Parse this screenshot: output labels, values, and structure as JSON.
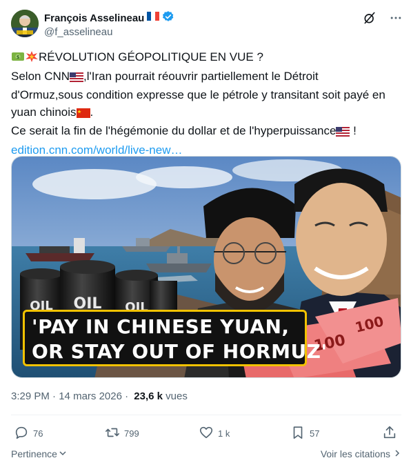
{
  "author": {
    "display_name": "François Asselineau",
    "handle": "@f_asselineau",
    "verified": true,
    "name_flag": "France flag"
  },
  "header_icons": [
    "grok-slash-icon",
    "more-dots-icon"
  ],
  "tweet": {
    "line1_text": "RÉVOLUTION GÉOPOLITIQUE EN VUE ?",
    "line2_a": "Selon CNN",
    "line2_b": ",l'Iran pourrait réouvrir partiellement le Détroit",
    "line3": "d'Ormuz,sous condition expresse que le pétrole y transitant soit payé en",
    "line4_a": "yuan chinois",
    "line4_b": ".",
    "line5_a": "Ce serait la fin de l'hégémonie du dollar et de l'hyperpuissance",
    "line5_b": " !",
    "link": "edition.cnn.com/world/live-new…"
  },
  "media": {
    "banner_line1": "'PAY IN CHINESE YUAN,",
    "banner_line2": "OR STAY OUT OF HORMUZ'",
    "barrel_label": "OIL"
  },
  "meta": {
    "time": "3:29 PM",
    "sep": " · ",
    "date": "14 mars 2026",
    "sep2": " · ",
    "views_count": "23,6 k",
    "views_label": " vues"
  },
  "actions": {
    "replies": "76",
    "reposts": "799",
    "likes": "1 k",
    "bookmarks": "57"
  },
  "footer": {
    "relevance": "Pertinence",
    "quotes": "Voir les citations"
  },
  "colors": {
    "link": "#1d9bf0",
    "muted": "#536471",
    "text": "#0f1419",
    "banner_border": "#f2c200"
  }
}
